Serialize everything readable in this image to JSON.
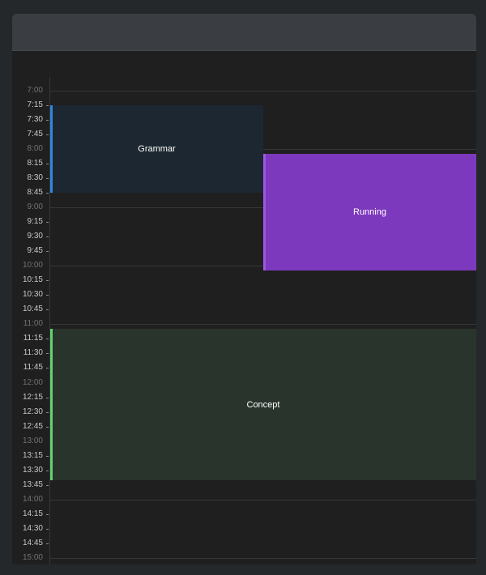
{
  "calendar": {
    "start_minutes": 420,
    "end_minutes": 900,
    "slots": [
      "7:00",
      "7:15",
      "7:30",
      "7:45",
      "8:00",
      "8:15",
      "8:30",
      "8:45",
      "9:00",
      "9:15",
      "9:30",
      "9:45",
      "10:00",
      "10:15",
      "10:30",
      "10:45",
      "11:00",
      "11:15",
      "11:30",
      "11:45",
      "12:00",
      "12:15",
      "12:30",
      "12:45",
      "13:00",
      "13:15",
      "13:30",
      "13:45",
      "14:00",
      "14:15",
      "14:30",
      "14:45",
      "15:00"
    ],
    "events": [
      {
        "title": "Grammar",
        "start": "7:15",
        "end": "8:45",
        "column": 0,
        "columns": 2,
        "background": "#1d2731",
        "accent": "#2f86e0"
      },
      {
        "title": "Running",
        "start": "8:05",
        "end": "10:05",
        "column": 1,
        "columns": 2,
        "background": "#7d39bd",
        "accent": "#9b59e0"
      },
      {
        "title": "Concept",
        "start": "11:05",
        "end": "13:40",
        "column": 0,
        "columns": 1,
        "background": "#29342d",
        "accent": "#63d26f"
      }
    ]
  }
}
